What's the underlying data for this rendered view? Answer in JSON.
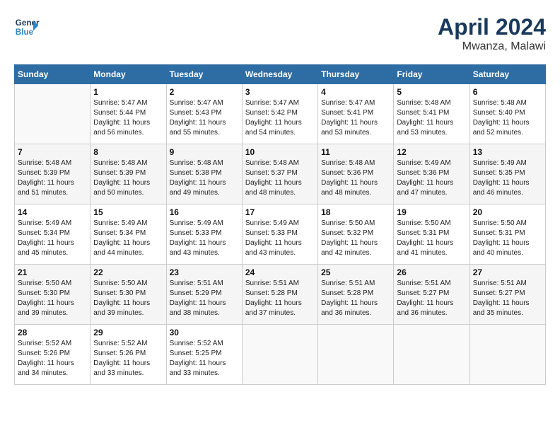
{
  "header": {
    "logo_line1": "General",
    "logo_line2": "Blue",
    "month": "April 2024",
    "location": "Mwanza, Malawi"
  },
  "columns": [
    "Sunday",
    "Monday",
    "Tuesday",
    "Wednesday",
    "Thursday",
    "Friday",
    "Saturday"
  ],
  "weeks": [
    [
      {
        "day": "",
        "info": ""
      },
      {
        "day": "1",
        "info": "Sunrise: 5:47 AM\nSunset: 5:44 PM\nDaylight: 11 hours\nand 56 minutes."
      },
      {
        "day": "2",
        "info": "Sunrise: 5:47 AM\nSunset: 5:43 PM\nDaylight: 11 hours\nand 55 minutes."
      },
      {
        "day": "3",
        "info": "Sunrise: 5:47 AM\nSunset: 5:42 PM\nDaylight: 11 hours\nand 54 minutes."
      },
      {
        "day": "4",
        "info": "Sunrise: 5:47 AM\nSunset: 5:41 PM\nDaylight: 11 hours\nand 53 minutes."
      },
      {
        "day": "5",
        "info": "Sunrise: 5:48 AM\nSunset: 5:41 PM\nDaylight: 11 hours\nand 53 minutes."
      },
      {
        "day": "6",
        "info": "Sunrise: 5:48 AM\nSunset: 5:40 PM\nDaylight: 11 hours\nand 52 minutes."
      }
    ],
    [
      {
        "day": "7",
        "info": "Sunrise: 5:48 AM\nSunset: 5:39 PM\nDaylight: 11 hours\nand 51 minutes."
      },
      {
        "day": "8",
        "info": "Sunrise: 5:48 AM\nSunset: 5:39 PM\nDaylight: 11 hours\nand 50 minutes."
      },
      {
        "day": "9",
        "info": "Sunrise: 5:48 AM\nSunset: 5:38 PM\nDaylight: 11 hours\nand 49 minutes."
      },
      {
        "day": "10",
        "info": "Sunrise: 5:48 AM\nSunset: 5:37 PM\nDaylight: 11 hours\nand 48 minutes."
      },
      {
        "day": "11",
        "info": "Sunrise: 5:48 AM\nSunset: 5:36 PM\nDaylight: 11 hours\nand 48 minutes."
      },
      {
        "day": "12",
        "info": "Sunrise: 5:49 AM\nSunset: 5:36 PM\nDaylight: 11 hours\nand 47 minutes."
      },
      {
        "day": "13",
        "info": "Sunrise: 5:49 AM\nSunset: 5:35 PM\nDaylight: 11 hours\nand 46 minutes."
      }
    ],
    [
      {
        "day": "14",
        "info": "Sunrise: 5:49 AM\nSunset: 5:34 PM\nDaylight: 11 hours\nand 45 minutes."
      },
      {
        "day": "15",
        "info": "Sunrise: 5:49 AM\nSunset: 5:34 PM\nDaylight: 11 hours\nand 44 minutes."
      },
      {
        "day": "16",
        "info": "Sunrise: 5:49 AM\nSunset: 5:33 PM\nDaylight: 11 hours\nand 43 minutes."
      },
      {
        "day": "17",
        "info": "Sunrise: 5:49 AM\nSunset: 5:33 PM\nDaylight: 11 hours\nand 43 minutes."
      },
      {
        "day": "18",
        "info": "Sunrise: 5:50 AM\nSunset: 5:32 PM\nDaylight: 11 hours\nand 42 minutes."
      },
      {
        "day": "19",
        "info": "Sunrise: 5:50 AM\nSunset: 5:31 PM\nDaylight: 11 hours\nand 41 minutes."
      },
      {
        "day": "20",
        "info": "Sunrise: 5:50 AM\nSunset: 5:31 PM\nDaylight: 11 hours\nand 40 minutes."
      }
    ],
    [
      {
        "day": "21",
        "info": "Sunrise: 5:50 AM\nSunset: 5:30 PM\nDaylight: 11 hours\nand 39 minutes."
      },
      {
        "day": "22",
        "info": "Sunrise: 5:50 AM\nSunset: 5:30 PM\nDaylight: 11 hours\nand 39 minutes."
      },
      {
        "day": "23",
        "info": "Sunrise: 5:51 AM\nSunset: 5:29 PM\nDaylight: 11 hours\nand 38 minutes."
      },
      {
        "day": "24",
        "info": "Sunrise: 5:51 AM\nSunset: 5:28 PM\nDaylight: 11 hours\nand 37 minutes."
      },
      {
        "day": "25",
        "info": "Sunrise: 5:51 AM\nSunset: 5:28 PM\nDaylight: 11 hours\nand 36 minutes."
      },
      {
        "day": "26",
        "info": "Sunrise: 5:51 AM\nSunset: 5:27 PM\nDaylight: 11 hours\nand 36 minutes."
      },
      {
        "day": "27",
        "info": "Sunrise: 5:51 AM\nSunset: 5:27 PM\nDaylight: 11 hours\nand 35 minutes."
      }
    ],
    [
      {
        "day": "28",
        "info": "Sunrise: 5:52 AM\nSunset: 5:26 PM\nDaylight: 11 hours\nand 34 minutes."
      },
      {
        "day": "29",
        "info": "Sunrise: 5:52 AM\nSunset: 5:26 PM\nDaylight: 11 hours\nand 33 minutes."
      },
      {
        "day": "30",
        "info": "Sunrise: 5:52 AM\nSunset: 5:25 PM\nDaylight: 11 hours\nand 33 minutes."
      },
      {
        "day": "",
        "info": ""
      },
      {
        "day": "",
        "info": ""
      },
      {
        "day": "",
        "info": ""
      },
      {
        "day": "",
        "info": ""
      }
    ]
  ]
}
